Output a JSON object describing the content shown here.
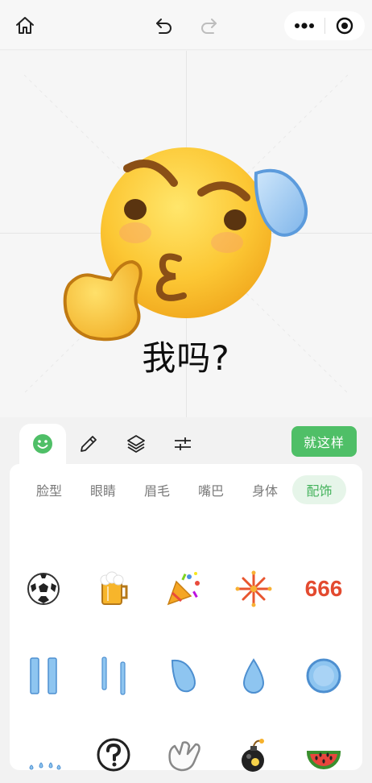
{
  "toolbar": {
    "home_icon": "home-icon",
    "undo_icon": "undo-icon",
    "redo_icon": "redo-icon",
    "more_icon": "more-dots-icon",
    "target_icon": "target-icon"
  },
  "canvas": {
    "caption": "我吗?"
  },
  "tools": [
    {
      "name": "smiley-face",
      "icon": "smiley-icon",
      "active": true
    },
    {
      "name": "pencil",
      "icon": "pencil-icon",
      "active": false
    },
    {
      "name": "layers",
      "icon": "layers-icon",
      "active": false
    },
    {
      "name": "adjust",
      "icon": "sliders-icon",
      "active": false
    }
  ],
  "done_button": "就这样",
  "categories": [
    {
      "label": "脸型",
      "active": false
    },
    {
      "label": "眼睛",
      "active": false
    },
    {
      "label": "眉毛",
      "active": false
    },
    {
      "label": "嘴巴",
      "active": false
    },
    {
      "label": "身体",
      "active": false
    },
    {
      "label": "配饰",
      "active": true
    }
  ],
  "accessories": [
    {
      "icon": "soccer-ball-icon"
    },
    {
      "icon": "beer-mug-icon"
    },
    {
      "icon": "party-popper-icon"
    },
    {
      "icon": "fireworks-icon"
    },
    {
      "icon": "text-666-icon",
      "text": "666"
    },
    {
      "icon": "tear-streams-icon"
    },
    {
      "icon": "thin-tear-streams-icon"
    },
    {
      "icon": "sweat-drop-icon"
    },
    {
      "icon": "water-drop-icon"
    },
    {
      "icon": "blue-ring-icon"
    },
    {
      "icon": "splash-drops-icon"
    },
    {
      "icon": "question-mark-icon"
    },
    {
      "icon": "hand-icon"
    },
    {
      "icon": "bomb-icon"
    },
    {
      "icon": "watermelon-icon"
    }
  ],
  "colors": {
    "accent": "#4fbf67",
    "accent_light": "#e6f5e9",
    "emoji_yellow": "#fcc734",
    "tear_blue": "#8ec5f0",
    "text_666": "#e34a2f"
  }
}
